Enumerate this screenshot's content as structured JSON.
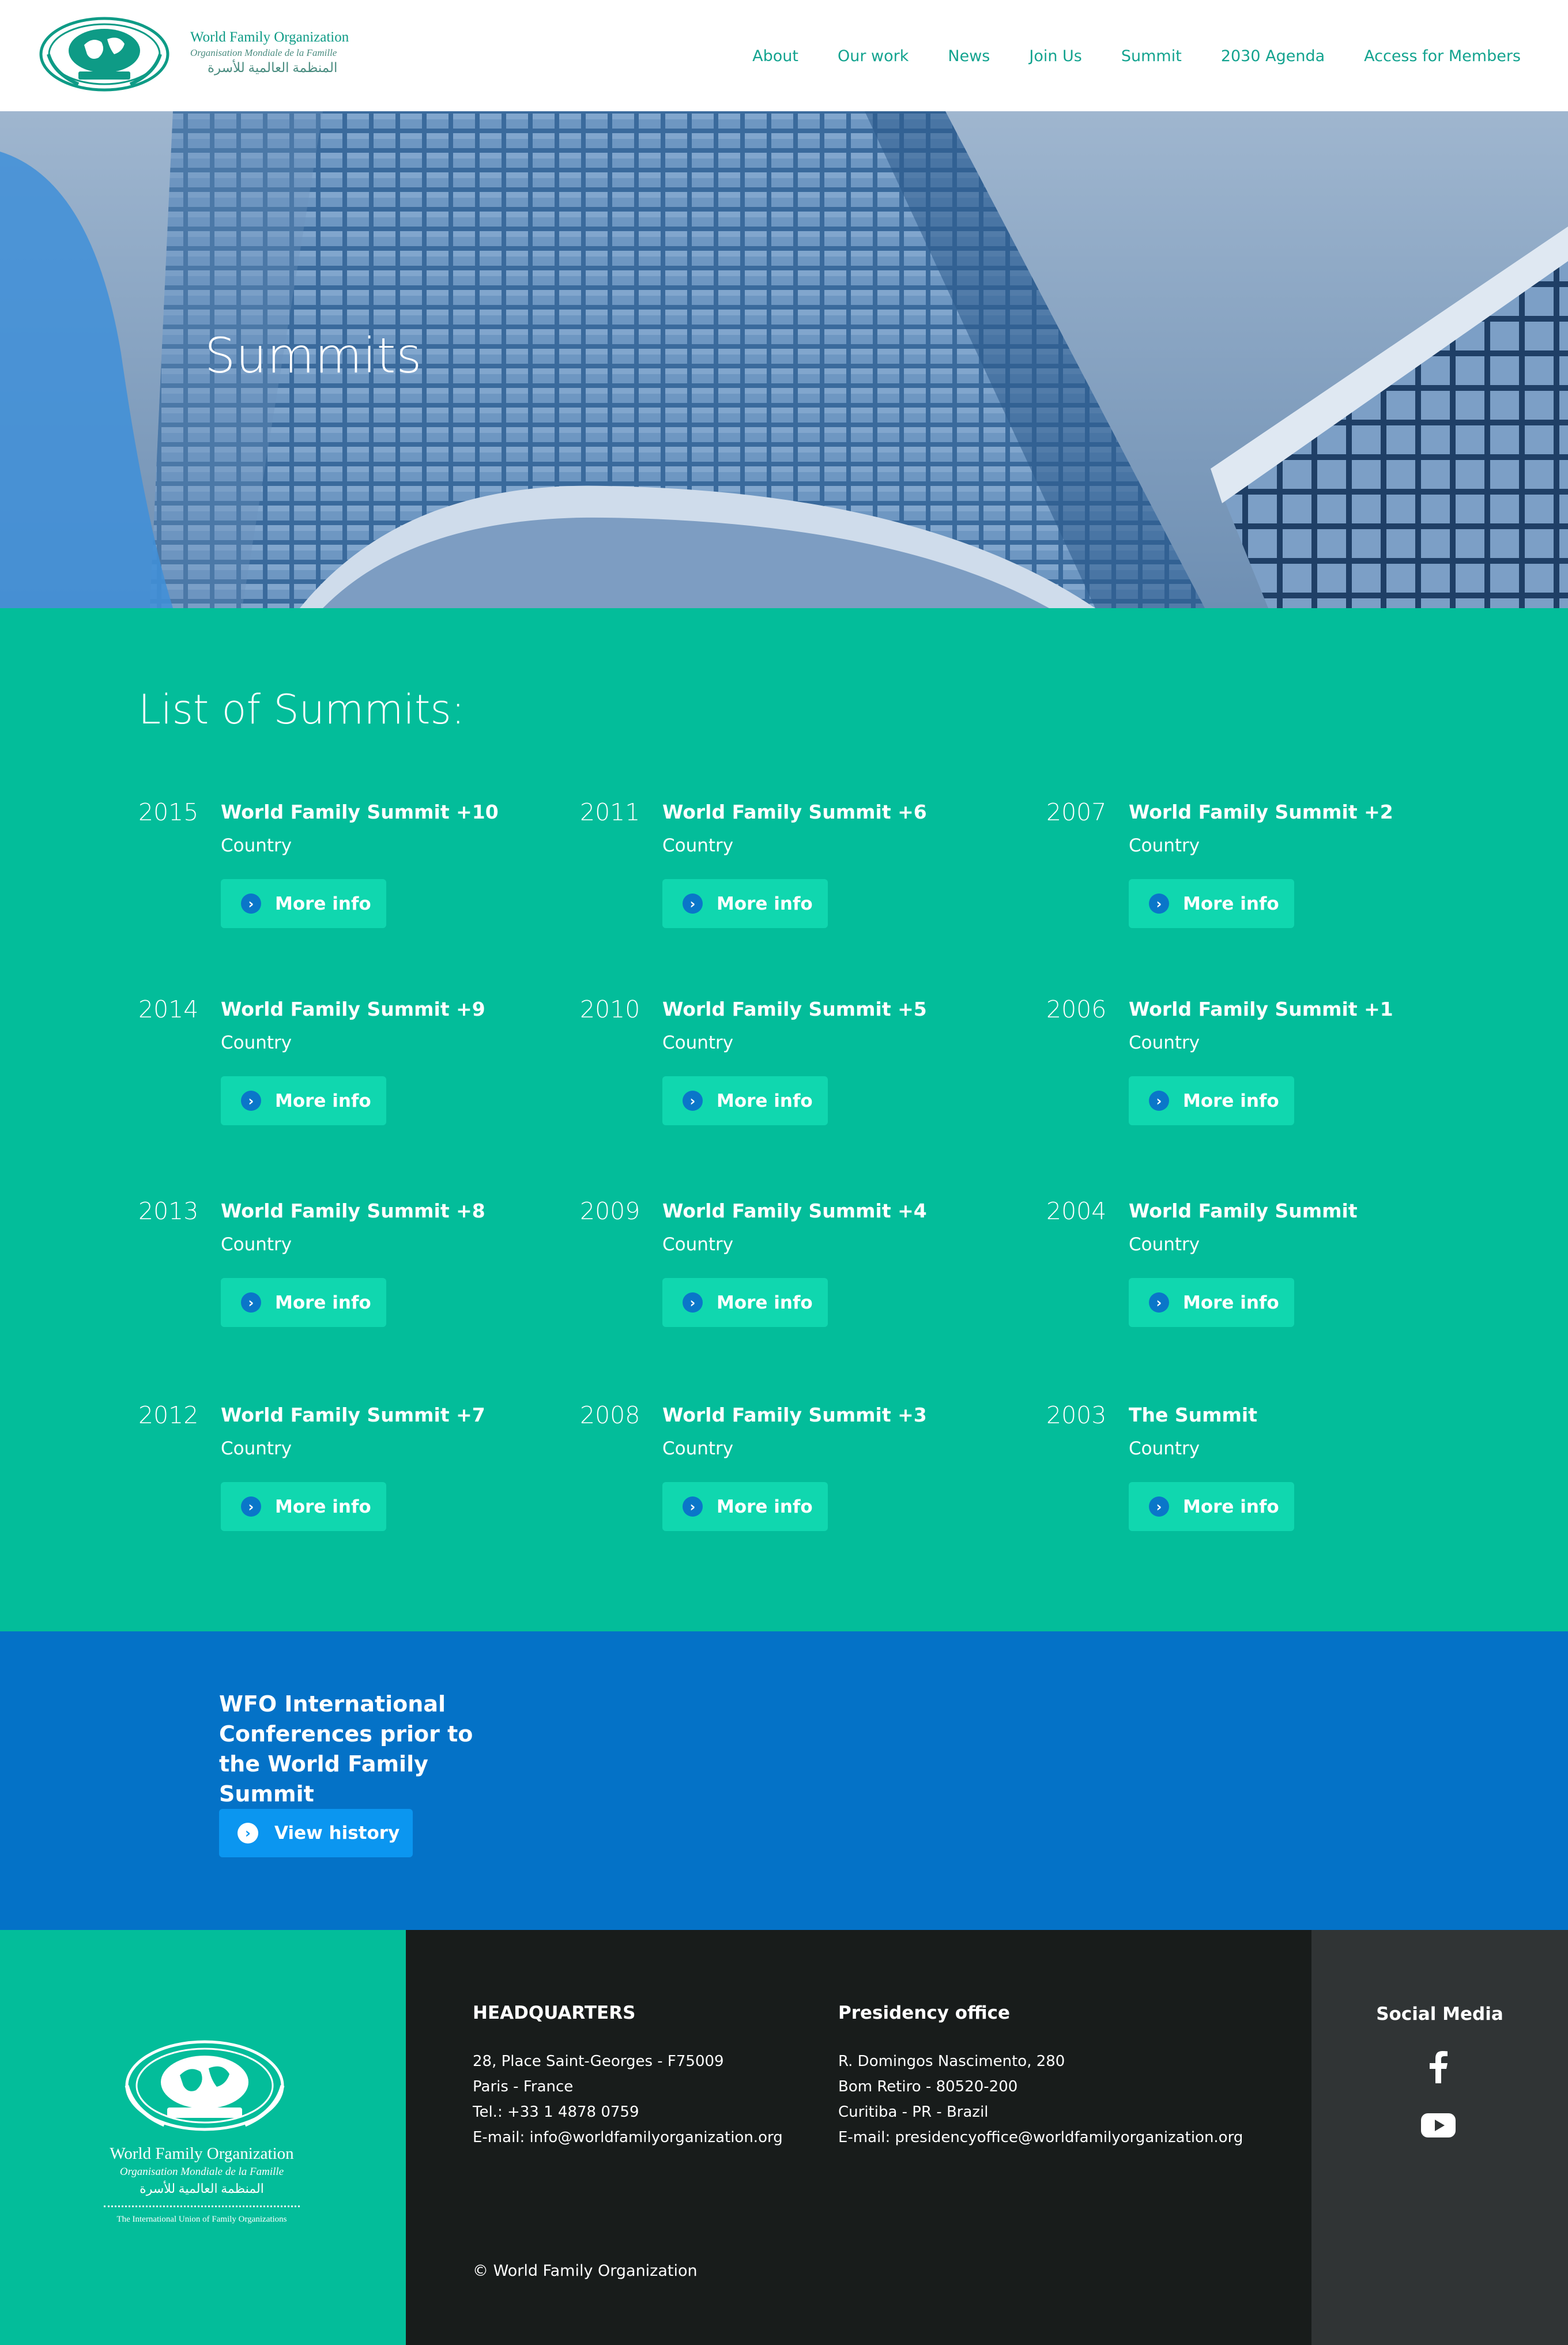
{
  "header": {
    "logo_line1": "World Family Organization",
    "logo_line2": "Organisation Mondiale de la Famille",
    "logo_line3": "المنظمة العالمية للأسرة",
    "nav": [
      {
        "label": "About"
      },
      {
        "label": "Our work"
      },
      {
        "label": "News"
      },
      {
        "label": "Join Us"
      },
      {
        "label": "Summit"
      },
      {
        "label": "2030 Agenda"
      },
      {
        "label": "Access for Members"
      }
    ]
  },
  "hero": {
    "title": "Summits"
  },
  "summits": {
    "heading": "List of Summits:",
    "button_label": "More info",
    "items": [
      {
        "year": "2015",
        "name": "World Family Summit +10",
        "country": "Country"
      },
      {
        "year": "2011",
        "name": "World Family Summit +6",
        "country": "Country"
      },
      {
        "year": "2007",
        "name": "World Family Summit +2",
        "country": "Country"
      },
      {
        "year": "2014",
        "name": "World Family Summit +9",
        "country": "Country"
      },
      {
        "year": "2010",
        "name": "World Family Summit +5",
        "country": "Country"
      },
      {
        "year": "2006",
        "name": "World Family Summit +1",
        "country": "Country"
      },
      {
        "year": "2013",
        "name": "World Family Summit +8",
        "country": "Country"
      },
      {
        "year": "2009",
        "name": "World Family Summit +4",
        "country": "Country"
      },
      {
        "year": "2004",
        "name": "World Family Summit",
        "country": "Country"
      },
      {
        "year": "2012",
        "name": "World Family Summit +7",
        "country": "Country"
      },
      {
        "year": "2008",
        "name": "World Family Summit +3",
        "country": "Country"
      },
      {
        "year": "2003",
        "name": "The Summit",
        "country": "Country"
      }
    ]
  },
  "history": {
    "title": "WFO International Conferences prior to the World Family Summit",
    "button_label": "View history"
  },
  "footer": {
    "logo_line1": "World Family Organization",
    "logo_line2": "Organisation Mondiale de la Famille",
    "logo_line3": "المنظمة العالمية للأسرة",
    "logo_line4": "The International Union of Family Organizations",
    "hq": {
      "heading": "HEADQUARTERS",
      "lines": [
        "28, Place Saint-Georges - F75009",
        "Paris - France",
        "Tel.: +33 1 4878 0759",
        "E-mail: info@worldfamilyorganization.org"
      ]
    },
    "presidency": {
      "heading": "Presidency office",
      "lines": [
        "R. Domingos Nascimento, 280",
        "Bom Retiro - 80520-200",
        "Curitiba - PR - Brazil",
        "E-mail: presidencyoffice@worldfamilyorganization.org"
      ]
    },
    "copyright": "© World Family Organization",
    "social": {
      "heading": "Social Media",
      "icons": [
        "facebook-icon",
        "youtube-icon"
      ]
    }
  },
  "colors": {
    "teal": "#03bd9a",
    "teal_button": "#10d7af",
    "blue": "#0472c7",
    "dark": "#181c1b",
    "nav_text": "#13a38f"
  }
}
